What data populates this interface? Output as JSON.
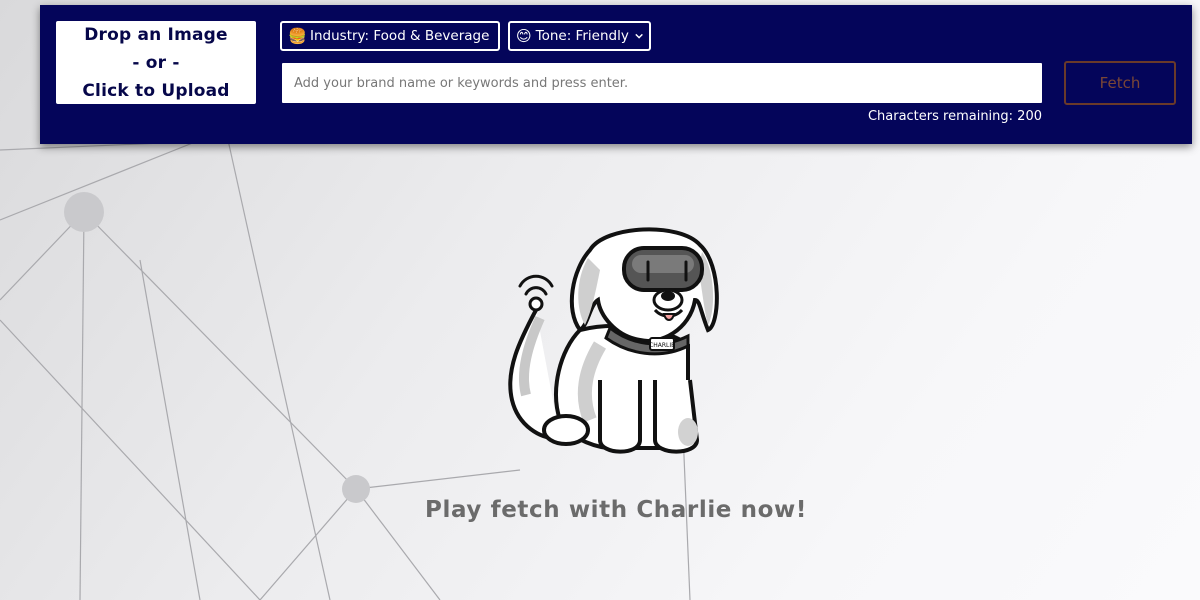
{
  "upload": {
    "line1": "Drop an Image",
    "line2": "- or -",
    "line3": "Click to Upload"
  },
  "filters": {
    "industry": {
      "icon": "burger-icon",
      "emoji": "🍔",
      "label": "Industry: Food & Beverage"
    },
    "tone": {
      "icon": "smiley-icon",
      "emoji": "😊",
      "label": "Tone: Friendly"
    }
  },
  "search": {
    "placeholder": "Add your brand name or keywords and press enter.",
    "value": ""
  },
  "characters_remaining": "Characters remaining: 200",
  "fetch_label": "Fetch",
  "tagline": "Play fetch with Charlie now!",
  "mascot": {
    "icon": "charlie-dog-mascot",
    "collar_tag": "CHARLIE"
  },
  "colors": {
    "toolbar_bg": "#04055a",
    "upload_text": "#06074a",
    "fetch_border": "#6a3a2a",
    "tagline": "#6b6b6b"
  }
}
